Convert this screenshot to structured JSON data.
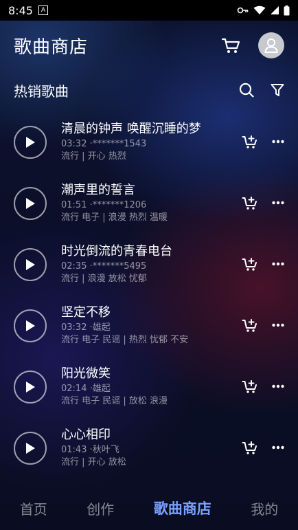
{
  "status_bar": {
    "time": "8:45",
    "notification": "A"
  },
  "header": {
    "title": "歌曲商店"
  },
  "section": {
    "title": "热销歌曲"
  },
  "songs": [
    {
      "title": "清晨的钟声 唤醒沉睡的梦",
      "meta": "03:32 ·*******1543",
      "tags": "流行 | 开心 热烈"
    },
    {
      "title": "潮声里的誓言",
      "meta": "01:51 ·*******1206",
      "tags": "流行 电子 | 浪漫 热烈 温暖"
    },
    {
      "title": "时光倒流的青春电台",
      "meta": "02:35 ·*******5495",
      "tags": "流行 | 浪漫 放松 忧郁"
    },
    {
      "title": "坚定不移",
      "meta": "03:32 ·雄起",
      "tags": "流行 电子 民谣 | 热烈 忧郁 不安"
    },
    {
      "title": "阳光微笑",
      "meta": "02:14 ·雄起",
      "tags": "流行 电子 民谣 | 放松 浪漫"
    },
    {
      "title": "心心相印",
      "meta": "01:43 ·秋叶飞",
      "tags": "流行 | 开心 放松"
    }
  ],
  "tabs": [
    "首页",
    "创作",
    "歌曲商店",
    "我的"
  ],
  "active_tab": "歌曲商店",
  "colors": {
    "accent": "#7aa0ff",
    "background": "#0b0f2a"
  },
  "icons": [
    "cart-icon",
    "profile-icon",
    "search-icon",
    "filter-icon",
    "play-icon",
    "add-to-cart-icon",
    "more-icon",
    "key-icon",
    "wifi-icon",
    "signal-icon",
    "battery-icon"
  ]
}
